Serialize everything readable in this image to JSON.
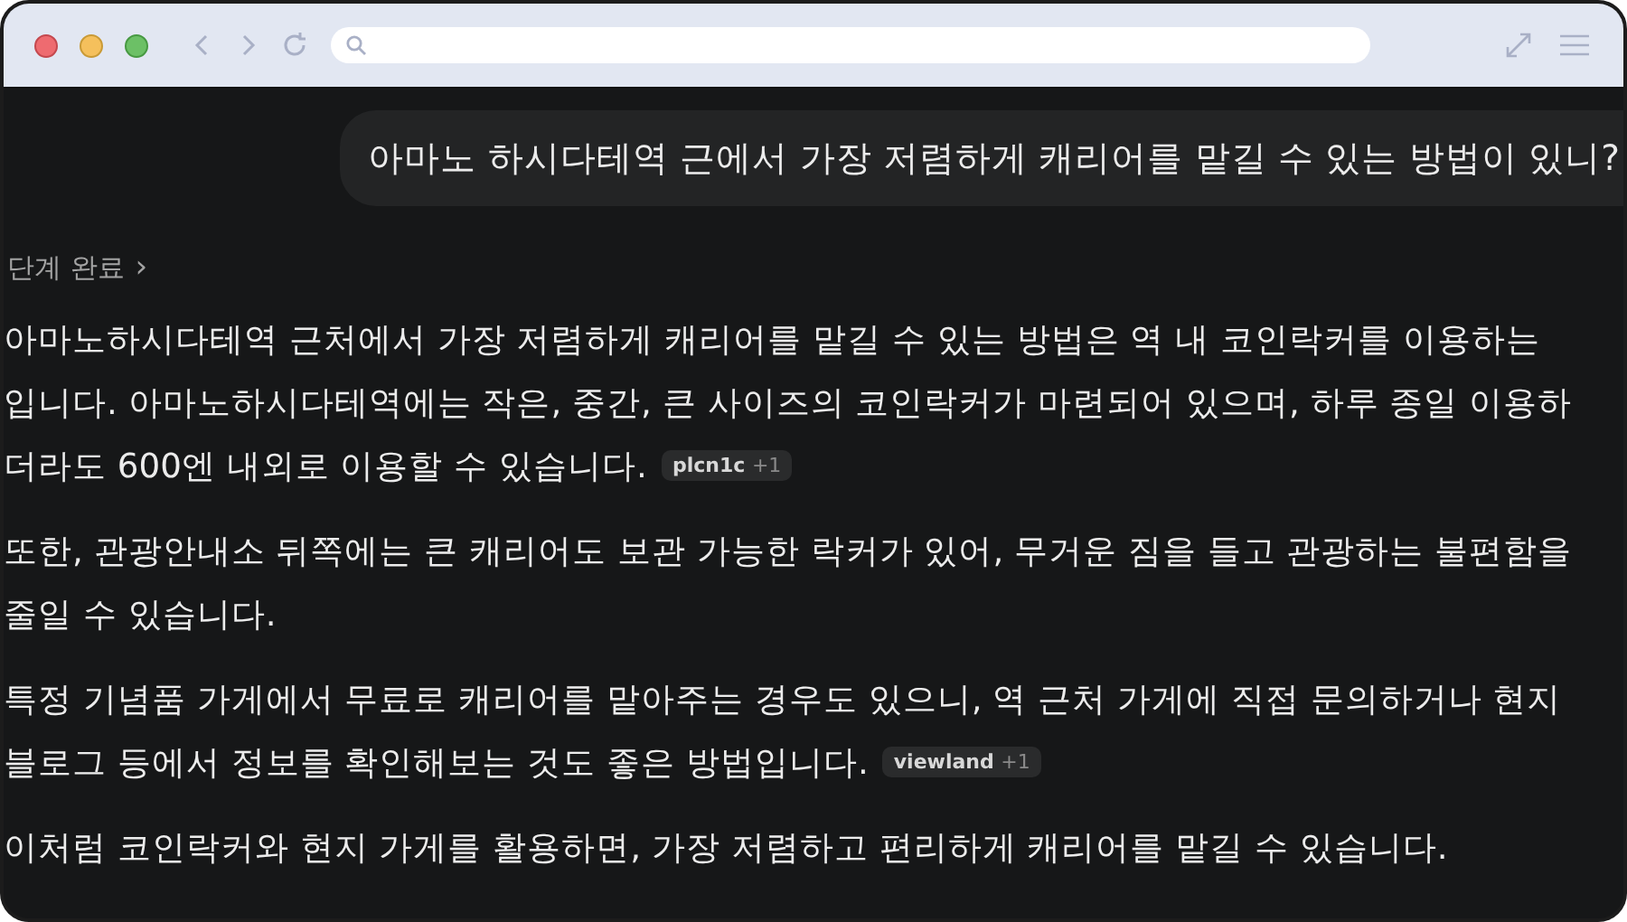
{
  "user_message": "아마노 하시다테역 근에서 가장 저렴하게 캐리어를 맡길 수 있는 방법이 있니?",
  "steps_toggle": {
    "label": "단계 완료",
    "chevron": "›"
  },
  "paragraphs": [
    {
      "lines": [
        "아마노하시다테역 근처에서 가장 저렴하게 캐리어를 맡길 수 있는 방법은 역 내 코인락커를 이용하는",
        "입니다. 아마노하시다테역에는 작은, 중간, 큰 사이즈의 코인락커가 마련되어 있으며, 하루 종일 이용하",
        "더라도 600엔 내외로 이용할 수 있습니다."
      ],
      "citation": {
        "source": "plcn1c",
        "more": "+1"
      }
    },
    {
      "lines": [
        "또한, 관광안내소 뒤쪽에는 큰 캐리어도 보관 가능한 락커가 있어, 무거운 짐을 들고 관광하는 불편함을",
        "줄일 수 있습니다."
      ]
    },
    {
      "lines": [
        "특정 기념품 가게에서 무료로 캐리어를 맡아주는 경우도 있으니, 역 근처 가게에 직접 문의하거나 현지",
        "블로그 등에서 정보를 확인해보는 것도 좋은 방법입니다."
      ],
      "citation": {
        "source": "viewland",
        "more": "+1"
      }
    },
    {
      "lines": [
        "이처럼 코인락커와 현지 가게를 활용하면, 가장 저렴하고 편리하게 캐리어를 맡길 수 있습니다."
      ]
    }
  ]
}
